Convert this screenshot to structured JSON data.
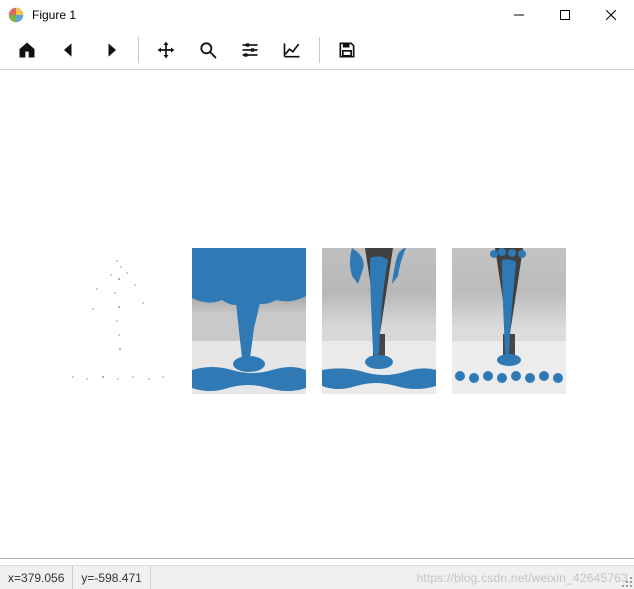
{
  "window": {
    "title": "Figure 1"
  },
  "toolbar": {
    "home": "Reset original view",
    "back": "Back to previous view",
    "forward": "Forward to next view",
    "pan": "Pan axes",
    "zoom": "Zoom to rectangle",
    "subplots": "Configure subplots",
    "edit": "Edit axis",
    "save": "Save the figure"
  },
  "status": {
    "x_label": "x=",
    "x_value": "379.056",
    "y_label": "y=",
    "y_value": "-598.471"
  },
  "watermark": "https://blog.csdn.net/weixin_42645763",
  "chart_data": [
    {
      "type": "scatter",
      "panel": 1,
      "description": "sparse light-grey point cloud forming faint funnel shape on white background",
      "overlay_color": null
    },
    {
      "type": "scatter",
      "panel": 2,
      "description": "dense blue point overlay covering upper region, funnel column, and ground band over grey photographic background",
      "overlay_color": "#2f79b5"
    },
    {
      "type": "scatter",
      "panel": 3,
      "description": "blue point overlay tracing dark funnel silhouette and ground band over lighter grey photographic background",
      "overlay_color": "#2f79b5"
    },
    {
      "type": "scatter",
      "panel": 4,
      "description": "sparser blue point overlay tracing funnel silhouette and ground band over lighter grey photographic background",
      "overlay_color": "#2f79b5"
    }
  ]
}
